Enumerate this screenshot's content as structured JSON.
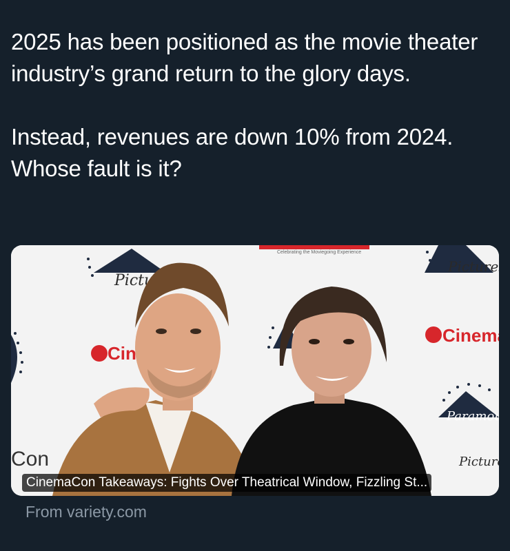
{
  "tweet": {
    "paragraph_1": "2025 has been positioned as the movie theater industry’s grand return to the glory days.",
    "paragraph_2": "Instead, revenues are down 10% from 2024. Whose fault is it?"
  },
  "link_card": {
    "title": "CinemaCon Takeaways: Fights Over Theatrical Window, Fizzling St...",
    "source": "From variety.com",
    "backdrop_logos": {
      "pictures": "Pictures",
      "cinema": "Cinema",
      "paramount": "Paramount",
      "tagline": "Celebrating the Moviegoing Experience",
      "con": "Con"
    }
  },
  "colors": {
    "background": "#15202b",
    "text": "#ffffff",
    "muted_text": "#8b98a5",
    "cinema_red": "#d7262b"
  }
}
